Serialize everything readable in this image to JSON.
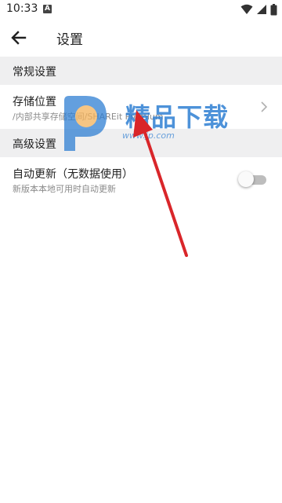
{
  "status_bar": {
    "time": "10:33",
    "notification_badge": "A",
    "icons": [
      "wifi-icon",
      "cellular-signal-icon",
      "battery-icon"
    ]
  },
  "app_bar": {
    "back_icon": "arrow-back-icon",
    "title": "设置"
  },
  "sections": [
    {
      "header": "常规设置",
      "items": [
        {
          "title": "存储位置",
          "summary": "/内部共享存储空间/SHAREit Premium",
          "icon": "chevron-right-icon"
        }
      ]
    },
    {
      "header": "高级设置",
      "items": [
        {
          "title": "自动更新（无数据使用）",
          "summary": "新版本本地可用时自动更新",
          "toggle_on": false
        }
      ]
    }
  ],
  "watermark": {
    "text": "精品下载",
    "url": "www.jp.com",
    "logo_icon": "p-logo-icon"
  },
  "annotation": {
    "icon": "red-arrow-icon",
    "color": "#d9262a"
  },
  "colors": {
    "section_bg": "#efeff0",
    "summary_text": "#8a8a8a",
    "watermark_blue": "#2f7fd3",
    "toggle_track_off": "#bdbdbd"
  }
}
